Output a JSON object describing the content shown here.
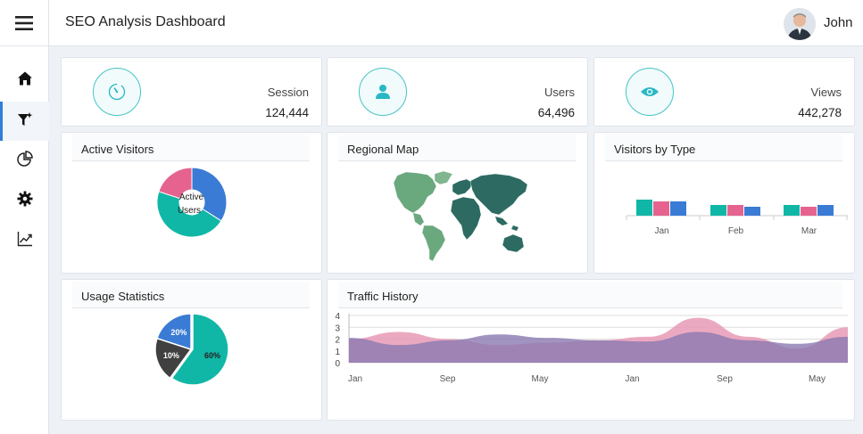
{
  "header": {
    "title": "SEO Analysis Dashboard",
    "user_name": "John",
    "menu_icon": "hamburger-icon"
  },
  "sidebar": {
    "items": [
      {
        "name": "home",
        "icon": "home-icon",
        "active": false
      },
      {
        "name": "filter",
        "icon": "filter-icon",
        "active": true
      },
      {
        "name": "pie-chart",
        "icon": "pie-chart-icon",
        "active": false
      },
      {
        "name": "settings",
        "icon": "gear-icon",
        "active": false
      },
      {
        "name": "trend",
        "icon": "trend-chart-icon",
        "active": false
      }
    ]
  },
  "stats": [
    {
      "label": "Session",
      "value": "124,444",
      "icon": "gauge-icon"
    },
    {
      "label": "Users",
      "value": "64,496",
      "icon": "user-icon"
    },
    {
      "label": "Views",
      "value": "442,278",
      "icon": "eye-icon"
    }
  ],
  "panels": {
    "active_visitors": "Active Visitors",
    "regional_map": "Regional Map",
    "visitors_by_type": "Visitors by Type",
    "usage_statistics": "Usage Statistics",
    "traffic_history": "Traffic History"
  },
  "colors": {
    "teal": "#11b7a6",
    "pink": "#e6638f",
    "blue": "#3a7bd5",
    "dark": "#404040",
    "map_light": "#6aa97e",
    "map_dark": "#2d6b62",
    "area_pink": "#e89ab6",
    "area_purple": "#8b79b0"
  },
  "chart_data": [
    {
      "type": "pie",
      "chart": "active_visitors",
      "center_label": "Active Users",
      "slices": [
        {
          "color": "#3a7bd5",
          "value": 34
        },
        {
          "color": "#11b7a6",
          "value": 46
        },
        {
          "color": "#e6638f",
          "value": 20
        }
      ]
    },
    {
      "type": "bar",
      "chart": "visitors_by_type",
      "categories": [
        "Jan",
        "Feb",
        "Mar"
      ],
      "series": [
        {
          "color": "#11b7a6",
          "values": [
            4.5,
            3,
            3
          ]
        },
        {
          "color": "#e6638f",
          "values": [
            4,
            3,
            2.5
          ]
        },
        {
          "color": "#3a7bd5",
          "values": [
            4,
            2.5,
            3
          ]
        }
      ],
      "ylim": [
        0,
        10
      ]
    },
    {
      "type": "pie",
      "chart": "usage_statistics",
      "slices": [
        {
          "label": "60%",
          "value": 60,
          "color": "#11b7a6"
        },
        {
          "label": "10%",
          "value": 20,
          "color": "#404040"
        },
        {
          "label": "20%",
          "value": 20,
          "color": "#3a7bd5"
        }
      ]
    },
    {
      "type": "area",
      "chart": "traffic_history",
      "categories": [
        "Jan",
        "Sep",
        "May",
        "Jan",
        "Sep",
        "May"
      ],
      "yticks": [
        "4",
        "3",
        "2",
        "1",
        "0"
      ],
      "ylim": [
        0,
        4
      ],
      "series": [
        {
          "color": "#e89ab6",
          "values": [
            2.0,
            2.6,
            2.0,
            1.5,
            1.7,
            1.9,
            2.2,
            3.8,
            2.2,
            1.2,
            3.0
          ]
        },
        {
          "color": "#8b79b0",
          "values": [
            2.1,
            1.5,
            1.9,
            2.4,
            2.1,
            1.9,
            1.8,
            2.6,
            1.9,
            1.6,
            2.2
          ]
        }
      ]
    }
  ]
}
